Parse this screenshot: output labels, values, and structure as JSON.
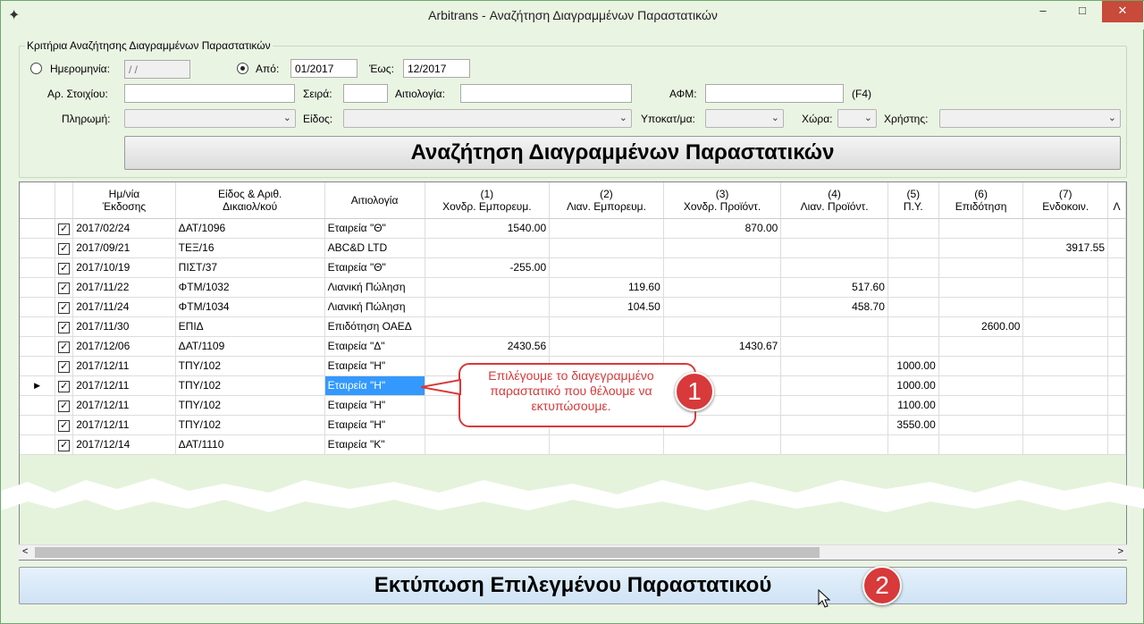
{
  "window": {
    "title": "Arbitrans - Αναζήτηση Διαγραμμένων Παραστατικών",
    "minimize": "–",
    "maximize": "□",
    "close": "✕",
    "app_icon": "✦"
  },
  "criteria": {
    "group_label": "Κριτήρια Αναζήτησης Διαγραμμένων Παραστατικών",
    "date_label": "Ημερομηνία:",
    "date_value": " / /",
    "from_label": "Από:",
    "from_value": "01/2017",
    "to_label": "Έως:",
    "to_value": "12/2017",
    "doc_no_label": "Αρ. Στοιχίου:",
    "series_label": "Σειρά:",
    "reason_label": "Αιτιολογία:",
    "afm_label": "ΑΦΜ:",
    "f4_hint": "(F4)",
    "payment_label": "Πληρωμή:",
    "type_label": "Είδος:",
    "subcat_label": "Υποκατ/μα:",
    "country_label": "Χώρα:",
    "user_label": "Χρήστης:",
    "search_button": "Αναζήτηση Διαγραμμένων Παραστατικών"
  },
  "grid": {
    "headers": [
      [
        "Ημ/νία",
        "Έκδοσης"
      ],
      [
        "Είδος & Αριθ.",
        "Δικαιολ/κού"
      ],
      [
        "Αιτιολογία",
        ""
      ],
      [
        "(1)",
        "Χονδρ. Εμπορευμ."
      ],
      [
        "(2)",
        "Λιαν. Εμπορευμ."
      ],
      [
        "(3)",
        "Χονδρ. Προϊόντ."
      ],
      [
        "(4)",
        "Λιαν. Προϊόντ."
      ],
      [
        "(5)",
        "Π.Υ."
      ],
      [
        "(6)",
        "Επιδότηση"
      ],
      [
        "(7)",
        "Ενδοκοιν."
      ],
      [
        "",
        "Λ"
      ]
    ],
    "rows": [
      [
        "2017/02/24",
        "ΔΑΤ/1096",
        "Εταιρεία \"Θ\"",
        "1540.00",
        "",
        "870.00",
        "",
        "",
        "",
        ""
      ],
      [
        "2017/09/21",
        "ΤΕΞ/16",
        "ABC&D LTD",
        "",
        "",
        "",
        "",
        "",
        "",
        "3917.55"
      ],
      [
        "2017/10/19",
        "ΠΙΣΤ/37",
        "Εταιρεία \"Θ\"",
        "-255.00",
        "",
        "",
        "",
        "",
        "",
        ""
      ],
      [
        "2017/11/22",
        "ΦΤΜ/1032",
        "Λιανική Πώληση",
        "",
        "119.60",
        "",
        "517.60",
        "",
        "",
        ""
      ],
      [
        "2017/11/24",
        "ΦΤΜ/1034",
        "Λιανική Πώληση",
        "",
        "104.50",
        "",
        "458.70",
        "",
        "",
        ""
      ],
      [
        "2017/11/30",
        "ΕΠΙΔ",
        "Επιδότηση ΟΑΕΔ",
        "",
        "",
        "",
        "",
        "",
        "2600.00",
        ""
      ],
      [
        "2017/12/06",
        "ΔΑΤ/1109",
        "Εταιρεία \"Δ\"",
        "2430.56",
        "",
        "1430.67",
        "",
        "",
        "",
        ""
      ],
      [
        "2017/12/11",
        "ΤΠΥ/102",
        "Εταιρεία \"Η\"",
        "",
        "",
        "",
        "",
        "1000.00",
        "",
        ""
      ],
      [
        "2017/12/11",
        "ΤΠΥ/102",
        "Εταιρεία \"Η\"",
        "",
        "",
        "",
        "",
        "1000.00",
        "",
        ""
      ],
      [
        "2017/12/11",
        "ΤΠΥ/102",
        "Εταιρεία \"Η\"",
        "",
        "",
        "",
        "",
        "1100.00",
        "",
        ""
      ],
      [
        "2017/12/11",
        "ΤΠΥ/102",
        "Εταιρεία \"Η\"",
        "",
        "",
        "",
        "",
        "3550.00",
        "",
        ""
      ],
      [
        "2017/12/14",
        "ΔΑΤ/1110",
        "Εταιρεία \"Κ\"",
        "",
        "",
        "",
        "",
        "",
        "",
        ""
      ]
    ],
    "selected_row": 8,
    "checked": true
  },
  "callout": {
    "text": "Επιλέγουμε το διαγεγραμμένο παραστατικό που θέλουμε να εκτυπώσουμε.",
    "badge1": "1",
    "badge2": "2"
  },
  "print_button": "Εκτύπωση Επιλεγμένου Παραστατικού",
  "scroll": {
    "left": "<",
    "right": ">"
  },
  "colors": {
    "accent": "#d8393a",
    "selection": "#3399ff",
    "window_bg": "#eaf4e3"
  }
}
